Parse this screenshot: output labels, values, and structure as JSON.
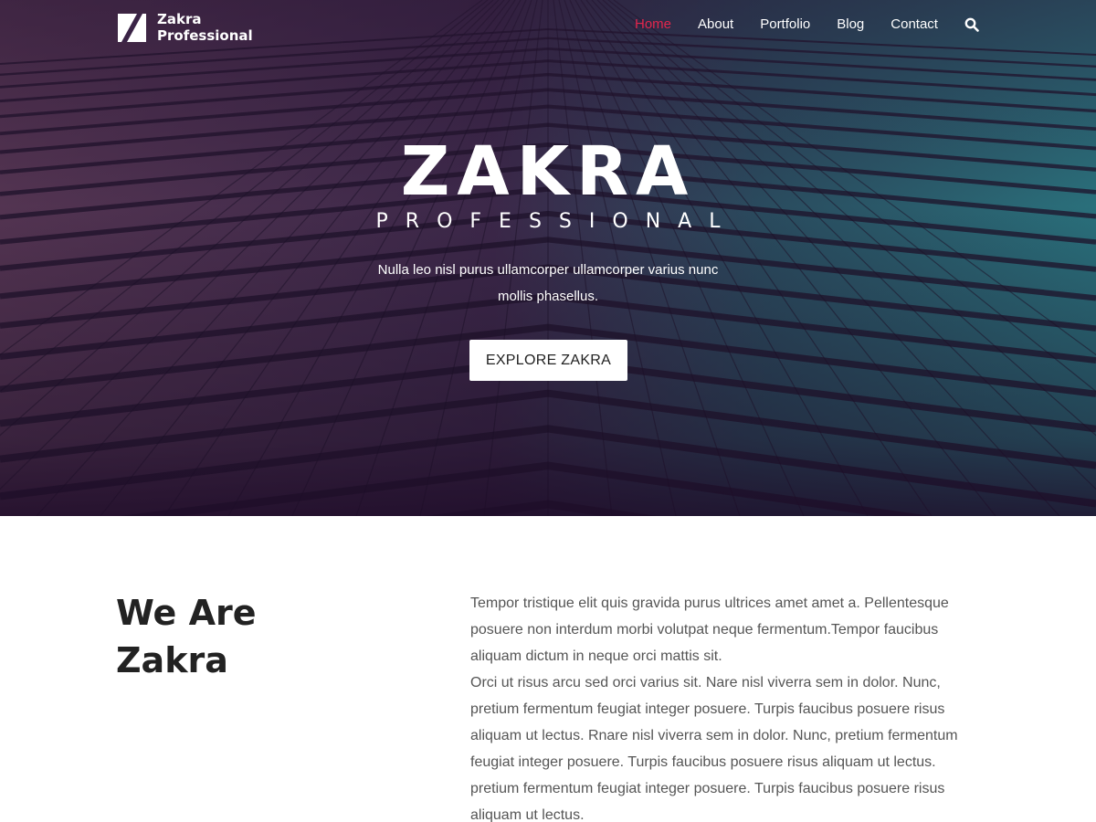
{
  "colors": {
    "accent": "#e2264d",
    "hero_purple": "#3a2346",
    "hero_teal": "#1e6a72",
    "heading": "#222222",
    "body_text": "#555555"
  },
  "header": {
    "logo_line1": "Zakra",
    "logo_line2": "Professional",
    "nav": [
      {
        "label": "Home",
        "active": true
      },
      {
        "label": "About",
        "active": false
      },
      {
        "label": "Portfolio",
        "active": false
      },
      {
        "label": "Blog",
        "active": false
      },
      {
        "label": "Contact",
        "active": false
      }
    ],
    "search_icon": "search-icon"
  },
  "hero": {
    "title": "ZAKRA",
    "subtitle": "PROFESSIONAL",
    "description": "Nulla leo nisl purus ullamcorper ullamcorper varius nunc mollis phasellus.",
    "button_label": "EXPLORE ZAKRA"
  },
  "about": {
    "heading_line1": "We Are",
    "heading_line2": "Zakra",
    "paragraph1": "Tempor tristique elit quis gravida purus ultrices amet amet a. Pellentesque posuere non interdum morbi volutpat neque fermentum.Tempor faucibus aliquam dictum in neque orci mattis sit.",
    "paragraph2": "Orci ut risus arcu sed orci varius sit. Nare nisl viverra sem in dolor. Nunc, pretium fermentum feugiat integer posuere. Turpis faucibus posuere risus aliquam ut lectus. Rnare nisl viverra sem in dolor. Nunc, pretium fermentum feugiat integer posuere. Turpis faucibus posuere risus aliquam ut lectus. pretium fermentum feugiat integer posuere. Turpis faucibus posuere risus aliquam ut lectus."
  }
}
